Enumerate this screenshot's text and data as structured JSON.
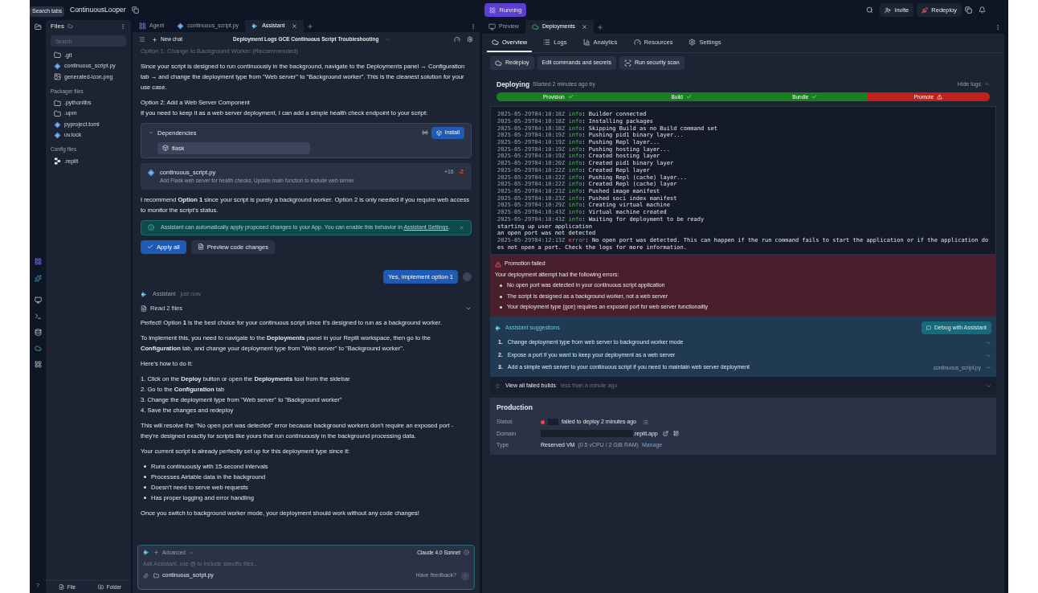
{
  "topbar": {
    "tooltip": "Search tabs",
    "project": "ContinuousLooper",
    "status": "Running",
    "invite": "Invite",
    "redeploy": "Redeploy"
  },
  "files": {
    "title": "Files",
    "search_placeholder": "Search",
    "sections": [
      {
        "items": [
          {
            "name": ".git",
            "kind": "folder"
          },
          {
            "name": "continuous_script.py",
            "kind": "python"
          },
          {
            "name": "generated-icon.png",
            "kind": "image"
          }
        ]
      },
      {
        "heading": "Packager files",
        "items": [
          {
            "name": ".pythonlibs",
            "kind": "folder"
          },
          {
            "name": ".upm",
            "kind": "folder"
          },
          {
            "name": "pyproject.toml",
            "kind": "python"
          },
          {
            "name": "uv.lock",
            "kind": "python"
          }
        ]
      },
      {
        "heading": "Config files",
        "items": [
          {
            "name": ".replit",
            "kind": "replit"
          }
        ]
      }
    ],
    "help": "?",
    "new_file": "File",
    "new_folder": "Folder"
  },
  "editor_tabs": [
    {
      "label": "Agent",
      "kind": "agent",
      "selected": false
    },
    {
      "label": "continuous_script.py",
      "kind": "python",
      "selected": false
    },
    {
      "label": "Assistant",
      "kind": "assistant",
      "selected": true
    }
  ],
  "chat": {
    "new_chat": "New chat",
    "title": "Deployment Logs GCE Continuous Script Troubleshooting",
    "blocks": [
      {
        "kind": "faded",
        "text": "Option 1: Change to Background Worker (Recommended)"
      },
      {
        "kind": "paragraph",
        "text": "Since your script is designed to run continuously in the background, navigate to the Deployments panel → Configuration tab → and change the deployment type from \"Web server\" to \"Background worker\". This is the cleanest solution for your use case."
      },
      {
        "kind": "lines",
        "lines": [
          "Option 2: Add a Web Server Component",
          "If you need to keep it as a web server deployment, I can add a simple health check endpoint to your script:"
        ]
      },
      {
        "kind": "dependencies",
        "title": "Dependencies",
        "button": "Install",
        "packages": [
          "flask"
        ]
      },
      {
        "kind": "file_change",
        "file": "continuous_script.py",
        "description": "Add Flask web server for health checks, Update main function to include web server",
        "added": "+16",
        "removed": "-2"
      },
      {
        "kind": "paragraph",
        "text": "I recommend **Option 1** since your script is purely a background worker. Option 2 is only needed if you require web access to monitor the script's status."
      },
      {
        "kind": "notice",
        "text": "Assistant can automatically apply proposed changes to your App. You can enable this behavior in",
        "link": "Assistant Settings",
        "end": "."
      },
      {
        "kind": "actions",
        "primary": "Apply all",
        "secondary": "Preview code changes"
      },
      {
        "kind": "user",
        "text": "Yes, implement option 1"
      },
      {
        "kind": "author",
        "name": "Assistant",
        "time": "just now"
      },
      {
        "kind": "read",
        "text": "Read 2 files"
      },
      {
        "kind": "paragraph",
        "text": "Perfect! Option **1** is the best choice for your continuous script since it's designed to run as a background worker."
      },
      {
        "kind": "paragraph",
        "text": "To implement this, you need to navigate to the **Deployments** panel in your Replit workspace, then go to the **Configuration** tab, and change your deployment type from \"Web server\" to \"Background worker\"."
      },
      {
        "kind": "paragraph",
        "text": "Here's how to do it:"
      },
      {
        "kind": "ordered",
        "items": [
          "1. Click on the **Deploy** button or open the **Deployments** tool from the sidebar",
          "2. Go to the **Configuration** tab",
          "3. Change the deployment type from \"Web server\" to \"Background worker\"",
          "4. Save the changes and redeploy"
        ]
      },
      {
        "kind": "paragraph",
        "text": "This will resolve the \"No open port was detected\" error because background workers don't require an exposed port - they're designed exactly for scripts like yours that run continuously in the background processing data."
      },
      {
        "kind": "paragraph",
        "text": "Your current script is already perfectly set up for this deployment type since it:"
      },
      {
        "kind": "bullets",
        "items": [
          "Runs continuously with 15-second intervals",
          "Processes Airtable data in the background",
          "Doesn't need to serve web requests",
          "Has proper logging and error handling"
        ]
      },
      {
        "kind": "paragraph",
        "text": "Once you switch to background worker mode, your deployment should work without any code changes!"
      }
    ],
    "composer": {
      "mode": "Advanced",
      "model": "Claude 4.0 Sonnet",
      "placeholder": "Ask Assistant, use @ to include specific files...",
      "attachment": "continuous_script.py",
      "feedback": "Have feedback?"
    }
  },
  "right_tabs": [
    {
      "label": "Preview",
      "kind": "preview",
      "selected": false
    },
    {
      "label": "Deployments",
      "kind": "deploy",
      "selected": true
    }
  ],
  "sub_tabs": [
    {
      "label": "Overview",
      "kind": "overview",
      "selected": true
    },
    {
      "label": "Logs",
      "kind": "logs",
      "selected": false
    },
    {
      "label": "Analytics",
      "kind": "analytics",
      "selected": false
    },
    {
      "label": "Resources",
      "kind": "resources",
      "selected": false
    },
    {
      "label": "Settings",
      "kind": "settings",
      "selected": false
    }
  ],
  "actions": [
    {
      "label": "Redeploy",
      "kind": "redeploy"
    },
    {
      "label": "Edit commands and secrets",
      "kind": "plain"
    },
    {
      "label": "Run security scan",
      "kind": "scan"
    }
  ],
  "deploying": {
    "title": "Deploying",
    "subtitle": "Started 2 minutes ago by",
    "hide": "Hide logs",
    "steps": [
      {
        "label": "Provision",
        "failed": false
      },
      {
        "label": "Build",
        "failed": false
      },
      {
        "label": "Bundle",
        "failed": false
      },
      {
        "label": "Promote",
        "failed": true
      }
    ],
    "logs": [
      {
        "time": "2025-05-29T04:10:18Z",
        "type": "info",
        "message": ": Builder connected"
      },
      {
        "time": "2025-05-29T04:10:18Z",
        "type": "info",
        "message": ": Installing packages"
      },
      {
        "time": "2025-05-29T04:10:18Z",
        "type": "info",
        "message": ": Skipping Build as no Build command set"
      },
      {
        "time": "2025-05-29T04:10:19Z",
        "type": "info",
        "message": ": Pushing pid1 binary layer..."
      },
      {
        "time": "2025-05-29T04:10:19Z",
        "type": "info",
        "message": ": Pushing Repl layer..."
      },
      {
        "time": "2025-05-29T04:10:19Z",
        "type": "info",
        "message": ": Pushing hosting layer..."
      },
      {
        "time": "2025-05-29T04:10:19Z",
        "type": "info",
        "message": ": Created hosting layer"
      },
      {
        "time": "2025-05-29T04:10:20Z",
        "type": "info",
        "message": ": Created pid1 binary layer"
      },
      {
        "time": "2025-05-29T04:10:22Z",
        "type": "info",
        "message": ": Created Repl layer"
      },
      {
        "time": "2025-05-29T04:10:22Z",
        "type": "info",
        "message": ": Pushing Repl (cache) layer..."
      },
      {
        "time": "2025-05-29T04:10:22Z",
        "type": "info",
        "message": ": Created Repl (cache) layer"
      },
      {
        "time": "2025-05-29T04:10:23Z",
        "type": "info",
        "message": ": Pushed image manifest"
      },
      {
        "time": "2025-05-29T04:10:23Z",
        "type": "info",
        "message": ": Pushed soci index manifest"
      },
      {
        "time": "2025-05-29T04:10:29Z",
        "type": "info",
        "message": ": Creating virtual machine"
      },
      {
        "time": "2025-05-29T04:10:43Z",
        "type": "info",
        "message": ": Virtual machine created"
      },
      {
        "time": "2025-05-29T04:10:43Z",
        "type": "info",
        "message": ": Waiting for deployment to be ready"
      },
      {
        "message": "starting up user application"
      },
      {
        "message": "an open port was not detected"
      },
      {
        "time": "2025-05-29T04:12:13Z",
        "type": "error",
        "message": ": No open port was detected. This can happen if the run command fails to start the application or if the application does not open a port. Check the logs for more information."
      }
    ],
    "failure": {
      "title": "Promotion failed",
      "intro": "Your deployment attempt had the following errors:",
      "errors": [
        "No open port was detected in your continuous script application",
        "The script is designed as a background worker, not a web server",
        "Your deployment type (gce) requires an exposed port for web server functionality"
      ]
    },
    "suggestions": {
      "title": "Assistant suggestions",
      "button": "Debug with Assistant",
      "items": [
        {
          "number": "1.",
          "text": "Change deployment type from web server to background worker mode"
        },
        {
          "number": "2.",
          "text": "Expose a port if you want to keep your deployment as a web server"
        },
        {
          "number": "3.",
          "text": "Add a simple web server to your continuous script if you need to maintain web server deployment",
          "file": "continuous_script.py"
        }
      ]
    }
  },
  "failed_builds": {
    "label": "View all failed builds",
    "time": "less than a minute ago"
  },
  "production": {
    "title": "Production",
    "rows": [
      {
        "label": "Status",
        "kind": "status",
        "value": "failed to deploy 2 minutes ago"
      },
      {
        "label": "Domain",
        "kind": "domain",
        "value": ".replit.app"
      },
      {
        "label": "Type",
        "kind": "type",
        "value": "Reserved VM",
        "detail": "(0.5 vCPU / 2 GiB RAM)",
        "link": "Manage"
      }
    ]
  }
}
